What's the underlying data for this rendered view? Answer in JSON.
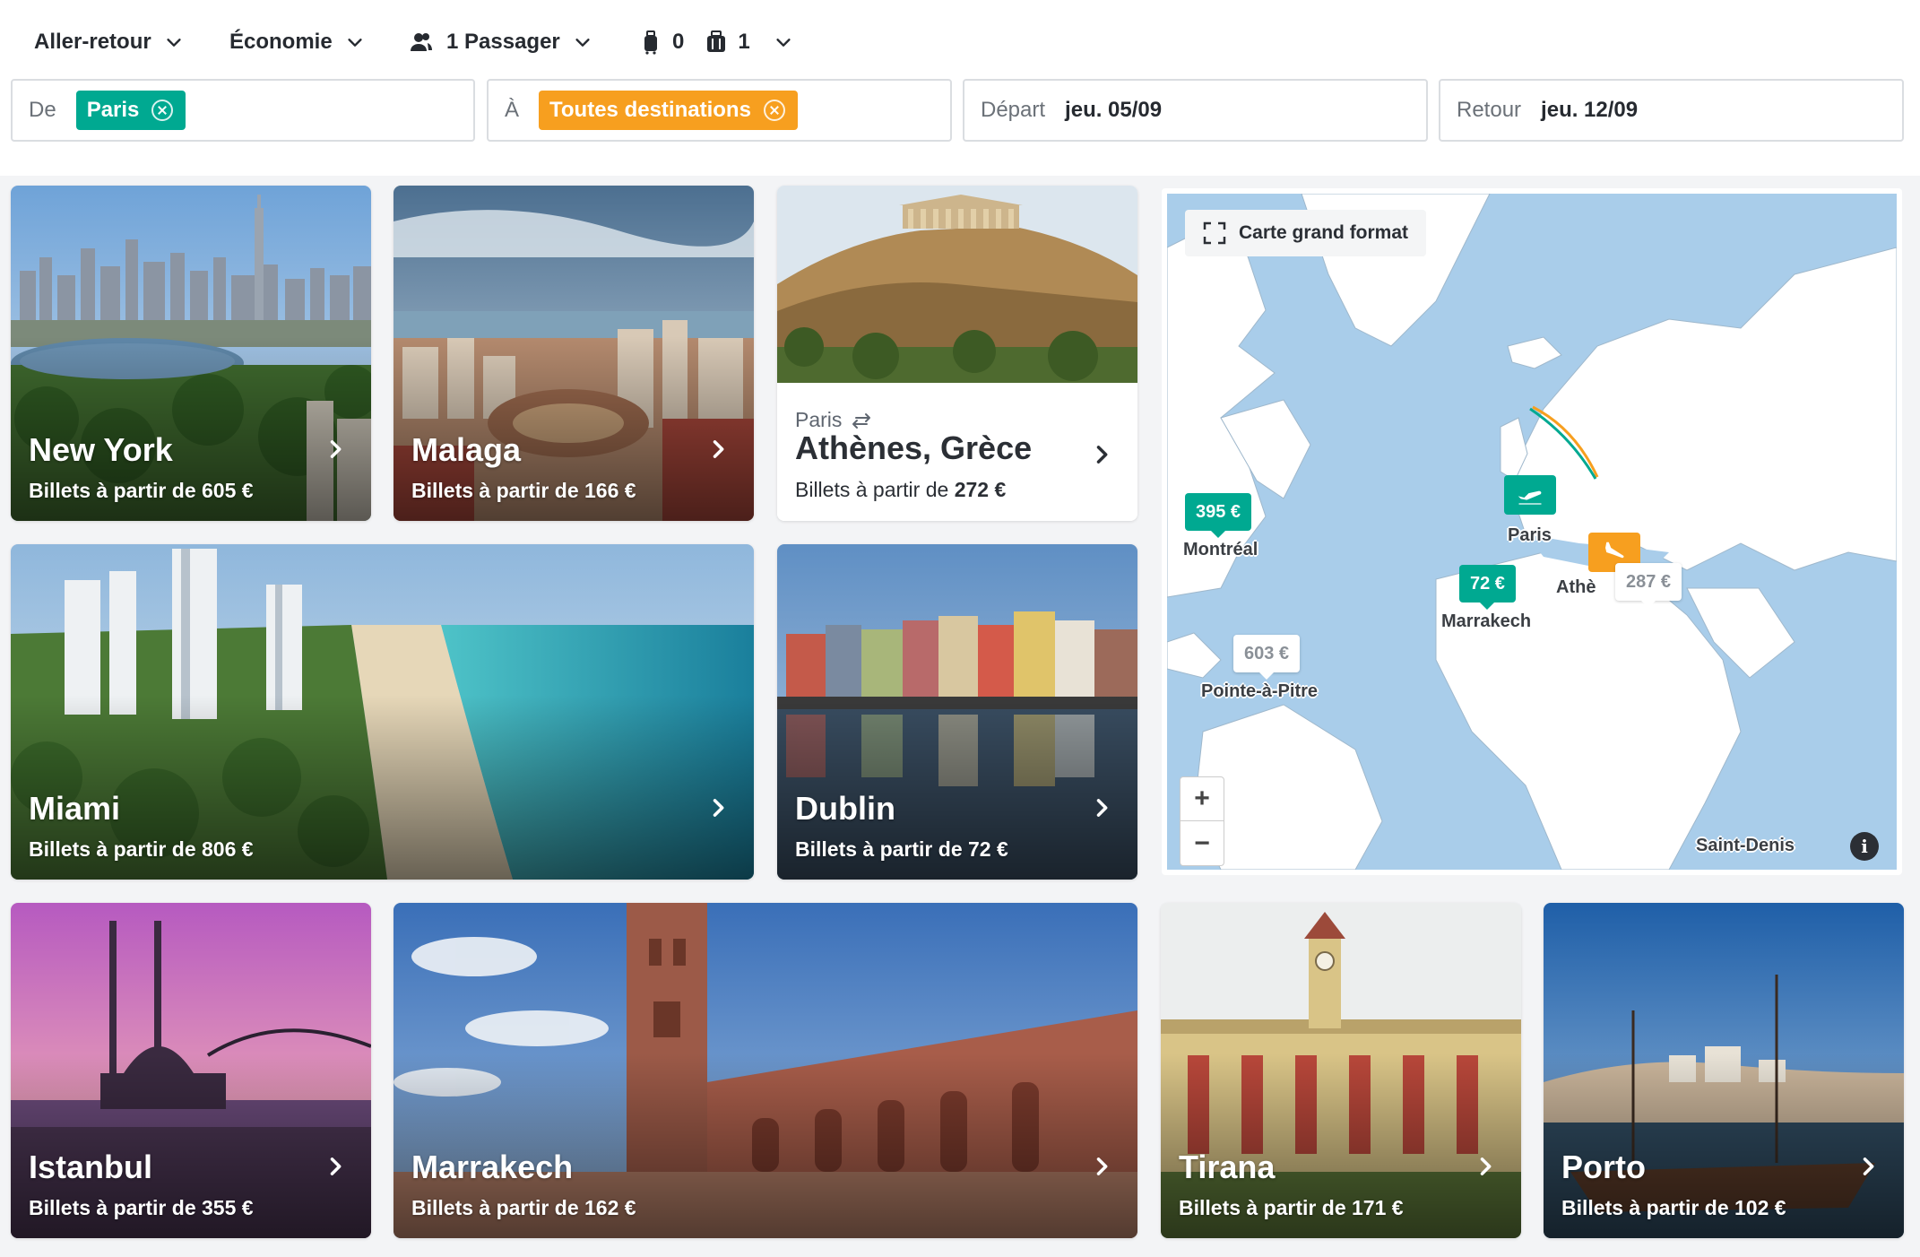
{
  "options": {
    "trip_type": "Aller-retour",
    "cabin": "Économie",
    "passengers": "1 Passager",
    "cabin_bags": "0",
    "checked_bags": "1"
  },
  "search": {
    "from_label": "De",
    "from_chip": "Paris",
    "to_label": "À",
    "to_chip": "Toutes destinations",
    "depart_label": "Départ",
    "depart_value": "jeu. 05/09",
    "return_label": "Retour",
    "return_value": "jeu. 12/09"
  },
  "price_prefix": "Billets à partir de",
  "cards": [
    {
      "city": "New York",
      "price": "605 €"
    },
    {
      "city": "Malaga",
      "price": "166 €"
    },
    {
      "city": "Athènes, Grèce",
      "origin": "Paris",
      "price": "272 €"
    },
    {
      "city": "Miami",
      "price": "806 €"
    },
    {
      "city": "Dublin",
      "price": "72 €"
    },
    {
      "city": "Istanbul",
      "price": "355 €"
    },
    {
      "city": "Marrakech",
      "price": "162 €"
    },
    {
      "city": "Tirana",
      "price": "171 €"
    },
    {
      "city": "Porto",
      "price": "102 €"
    }
  ],
  "map": {
    "fullscreen_label": "Carte grand format",
    "zoom_in": "+",
    "zoom_out": "−",
    "info": "i",
    "pins": {
      "montreal_price": "395 €",
      "marrakech_price": "72 €",
      "pointe_price": "603 €",
      "athens_price": "287 €"
    },
    "labels": {
      "montreal": "Montréal",
      "paris": "Paris",
      "athens": "Athè",
      "marrakech": "Marrakech",
      "pointe": "Pointe-à-Pitre",
      "saint_denis": "Saint-Denis"
    }
  },
  "colors": {
    "accent_green": "#00a991",
    "accent_orange": "#f79f1f",
    "sea": "#a9cdea",
    "land": "#ffffff"
  }
}
